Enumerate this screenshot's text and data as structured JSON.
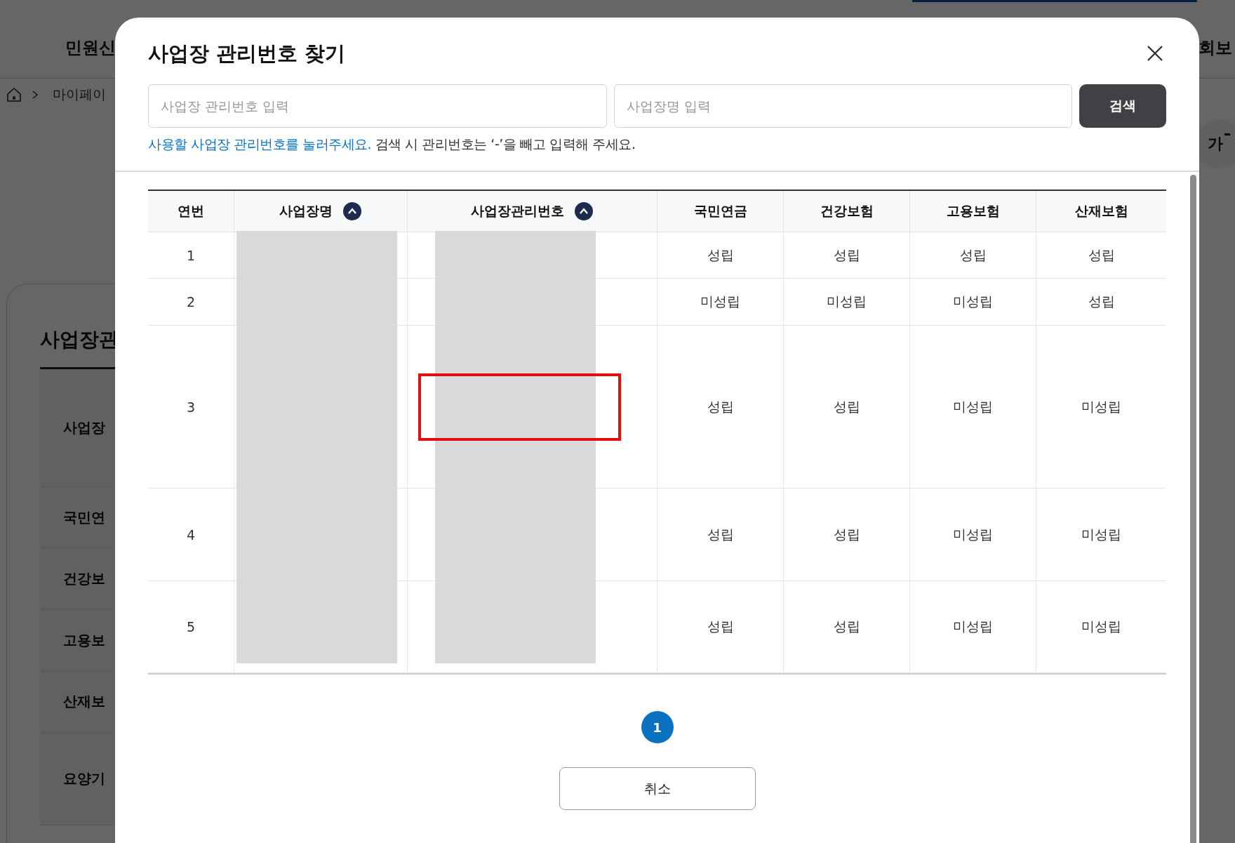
{
  "background_page": {
    "nav_item": "민원신",
    "nav_item_right": "회보",
    "breadcrumb": "마이페이",
    "font_size_button": "가",
    "section_title": "사업장관",
    "rows": [
      "사업장",
      "국민연",
      "건강보",
      "고용보",
      "산재보",
      "요양기"
    ]
  },
  "dialog": {
    "title": "사업장 관리번호 찾기",
    "search_fields": [
      {
        "placeholder": "사업장 관리번호 입력"
      },
      {
        "placeholder": "사업장명 입력"
      }
    ],
    "search_button": "검색",
    "instruction": "사용할 사업장 관리번호를 눌러주세요.",
    "hint": "검색 시 관리번호는 ‘-’을 빼고 입력해 주세요.",
    "table": {
      "columns": [
        {
          "label": "연번",
          "sortable": false,
          "redacted": false
        },
        {
          "label": "사업장명",
          "sortable": true,
          "redacted": true
        },
        {
          "label": "사업장관리번호",
          "sortable": true,
          "redacted": true
        },
        {
          "label": "국민연금",
          "sortable": false,
          "redacted": false
        },
        {
          "label": "건강보험",
          "sortable": false,
          "redacted": false
        },
        {
          "label": "고용보험",
          "sortable": false,
          "redacted": false
        },
        {
          "label": "산재보험",
          "sortable": false,
          "redacted": false
        }
      ],
      "rows": [
        {
          "number": "1",
          "statuses": [
            "성립",
            "성립",
            "성립",
            "성립"
          ],
          "highlighted": false
        },
        {
          "number": "2",
          "statuses": [
            "미성립",
            "미성립",
            "미성립",
            "성립"
          ],
          "highlighted": false
        },
        {
          "number": "3",
          "statuses": [
            "성립",
            "성립",
            "미성립",
            "미성립"
          ],
          "highlighted": true
        },
        {
          "number": "4",
          "statuses": [
            "성립",
            "성립",
            "미성립",
            "미성립"
          ],
          "highlighted": false
        },
        {
          "number": "5",
          "statuses": [
            "성립",
            "성립",
            "미성립",
            "미성립"
          ],
          "highlighted": false
        }
      ]
    },
    "pagination": [
      {
        "label": "1",
        "selected": true
      }
    ],
    "cancel_button": "취소"
  }
}
